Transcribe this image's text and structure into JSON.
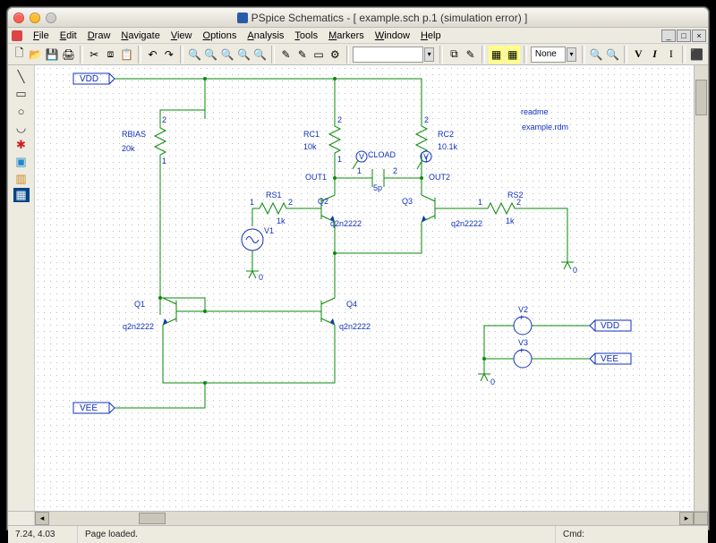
{
  "title": "PSpice Schematics - [ example.sch  p.1 (simulation error)  ]",
  "menu": [
    "File",
    "Edit",
    "Draw",
    "Navigate",
    "View",
    "Options",
    "Analysis",
    "Tools",
    "Markers",
    "Window",
    "Help"
  ],
  "layer_combo": "None",
  "schematic": {
    "readme": {
      "title": "readme",
      "file": "example.rdm"
    },
    "ports": {
      "vdd_top": "VDD",
      "vee_bot": "VEE",
      "vdd_r": "VDD",
      "vee_r": "VEE"
    },
    "parts": {
      "RBIAS": {
        "ref": "RBIAS",
        "val": "20k"
      },
      "RC1": {
        "ref": "RC1",
        "val": "10k"
      },
      "RC2": {
        "ref": "RC2",
        "val": "10.1k"
      },
      "RS1": {
        "ref": "RS1",
        "val": "1k"
      },
      "RS2": {
        "ref": "RS2",
        "val": "1k"
      },
      "CLOAD": {
        "ref": "CLOAD",
        "val": "5p"
      },
      "V1": {
        "ref": "V1"
      },
      "V2": {
        "ref": "V2"
      },
      "V3": {
        "ref": "V3"
      },
      "Q1": {
        "ref": "Q1",
        "mdl": "q2n2222"
      },
      "Q2": {
        "ref": "Q2",
        "mdl": "q2n2222"
      },
      "Q3": {
        "ref": "Q3",
        "mdl": "q2n2222"
      },
      "Q4": {
        "ref": "Q4",
        "mdl": "q2n2222"
      }
    },
    "nets": {
      "out1": "OUT1",
      "out2": "OUT2"
    },
    "pins": {
      "one": "1",
      "two": "2"
    },
    "gnd": "0"
  },
  "status": {
    "coord": "7.24,  4.03",
    "msg": "Page loaded.",
    "cmd": "Cmd:"
  }
}
